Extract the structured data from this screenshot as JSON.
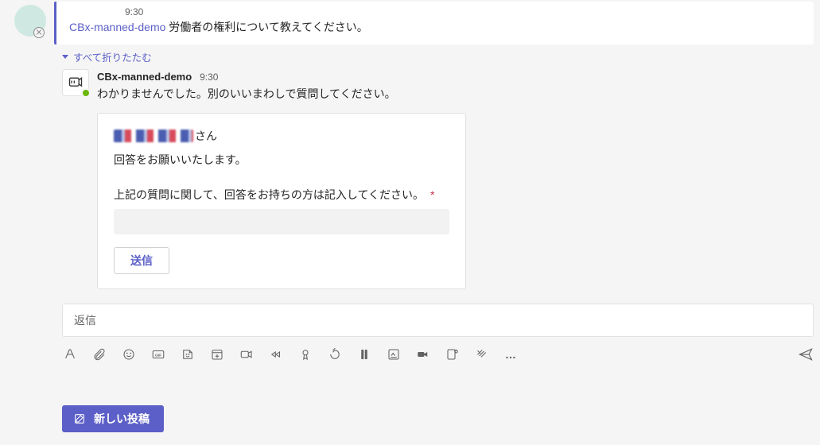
{
  "op": {
    "time": "9:30",
    "author": "CBx-manned-demo",
    "text": "労働者の権利について教えてください。"
  },
  "collapse_link": "すべて折りたたむ",
  "reply": {
    "author": "CBx-manned-demo",
    "time": "9:30",
    "text": "わかりませんでした。別のいいまわしで質問してください。"
  },
  "card": {
    "honorific": "さん",
    "subtitle": "回答をお願いいたします。",
    "prompt": "上記の質問に関して、回答をお持ちの方は記入してください。",
    "required_mark": "*",
    "submit_label": "送信"
  },
  "reply_box_placeholder": "返信",
  "new_post_label": "新しい投稿",
  "more_label": "…"
}
